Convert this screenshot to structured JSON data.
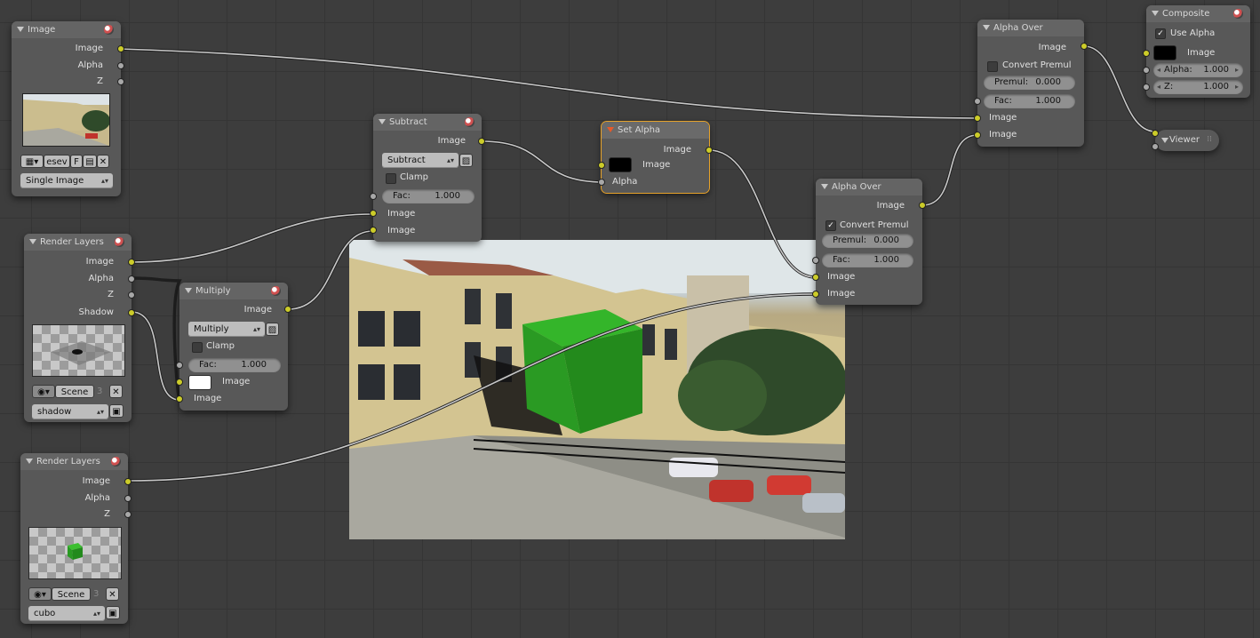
{
  "colors": {
    "socket_image": "#cccc29",
    "socket_value": "#a8a8a8",
    "node_body": "#585858",
    "node_header": "#646464",
    "active_outline": "#e6a22a",
    "grid_bg": "#3d3d3d"
  },
  "image_node": {
    "title": "Image",
    "out_image": "Image",
    "out_alpha": "Alpha",
    "out_z": "Z",
    "datablock": "esev",
    "fake_user": "F",
    "source": "Single Image"
  },
  "rl_shadow": {
    "title": "Render Layers",
    "out_image": "Image",
    "out_alpha": "Alpha",
    "out_z": "Z",
    "out_shadow": "Shadow",
    "scene": "Scene",
    "users": "3",
    "layer": "shadow"
  },
  "rl_cubo": {
    "title": "Render Layers",
    "out_image": "Image",
    "out_alpha": "Alpha",
    "out_z": "Z",
    "scene": "Scene",
    "users": "3",
    "layer": "cubo"
  },
  "multiply": {
    "title": "Multiply",
    "out_image": "Image",
    "blend_type": "Multiply",
    "clamp": "Clamp",
    "fac_label": "Fac:",
    "fac_value": "1.000",
    "in_image1": "Image",
    "in_image2": "Image"
  },
  "subtract": {
    "title": "Subtract",
    "out_image": "Image",
    "blend_type": "Subtract",
    "clamp": "Clamp",
    "fac_label": "Fac:",
    "fac_value": "1.000",
    "in_image1": "Image",
    "in_image2": "Image"
  },
  "set_alpha": {
    "title": "Set Alpha",
    "out_image": "Image",
    "in_image": "Image",
    "in_alpha": "Alpha"
  },
  "alpha_over_1": {
    "title": "Alpha Over",
    "out_image": "Image",
    "convert_premul": "Convert Premul",
    "premul_label": "Premul:",
    "premul_value": "0.000",
    "fac_label": "Fac:",
    "fac_value": "1.000",
    "in_image1": "Image",
    "in_image2": "Image"
  },
  "alpha_over_2": {
    "title": "Alpha Over",
    "out_image": "Image",
    "convert_premul": "Convert Premul",
    "premul_label": "Premul:",
    "premul_value": "0.000",
    "fac_label": "Fac:",
    "fac_value": "1.000",
    "in_image1": "Image",
    "in_image2": "Image"
  },
  "composite": {
    "title": "Composite",
    "use_alpha": "Use Alpha",
    "in_image": "Image",
    "alpha_label": "Alpha:",
    "alpha_value": "1.000",
    "z_label": "Z:",
    "z_value": "1.000"
  },
  "viewer": {
    "title": "Viewer"
  }
}
